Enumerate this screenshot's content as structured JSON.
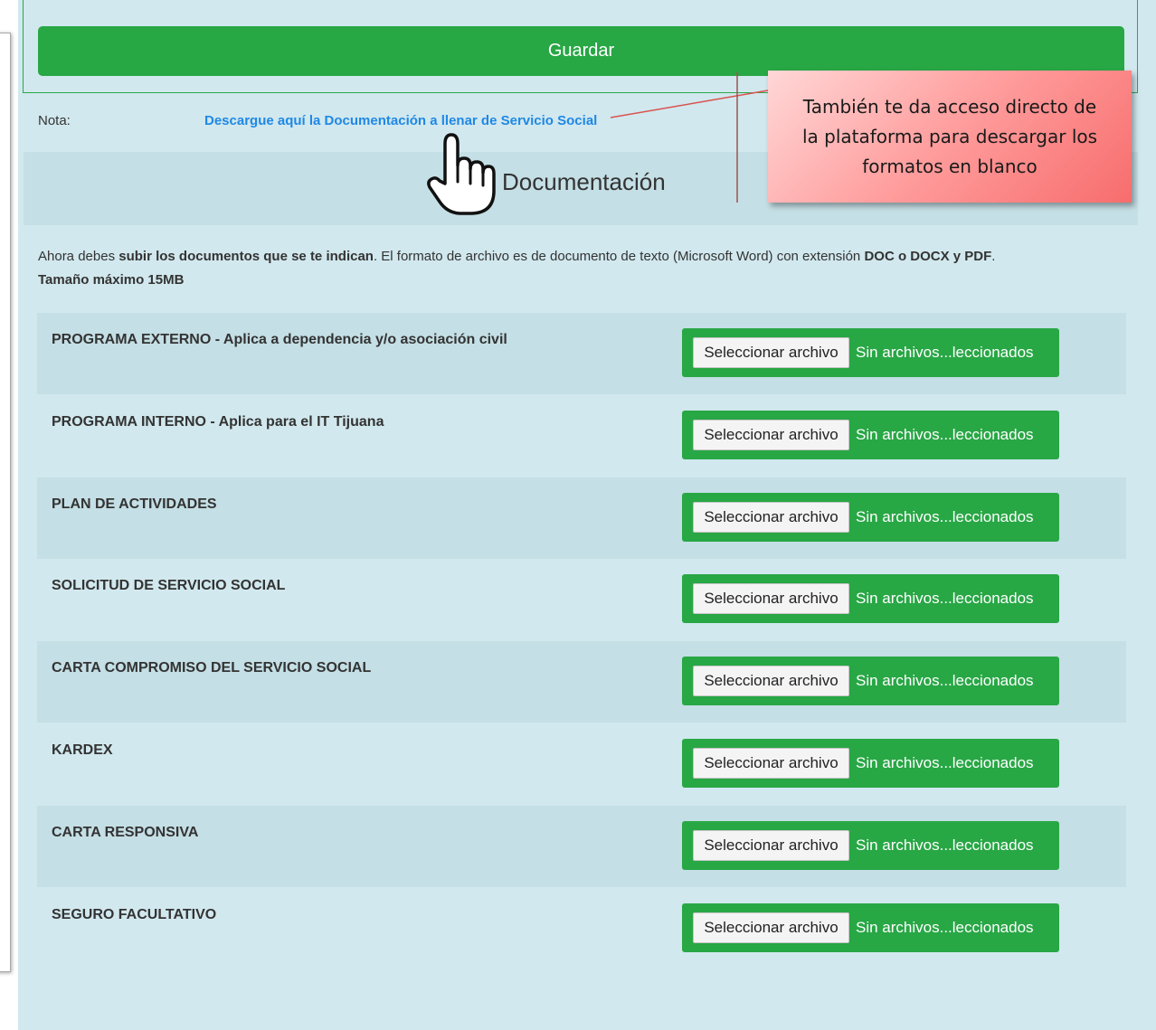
{
  "toolbar": {
    "save_label": "Guardar"
  },
  "note": {
    "label": "Nota:",
    "link_text": "Descargue aquí la Documentación a llenar de Servicio Social"
  },
  "section": {
    "title": "Documentación"
  },
  "instructions": {
    "part1": "Ahora debes ",
    "bold1": "subir los documentos que se te indican",
    "part2": ". El formato de archivo es de documento de texto (Microsoft Word) con extensión ",
    "bold2": "DOC o DOCX y PDF",
    "part3": ".",
    "line2": "Tamaño máximo 15MB"
  },
  "documents": [
    {
      "label": "PROGRAMA EXTERNO - Aplica a dependencia y/o asociación civil",
      "button": "Seleccionar archivo",
      "status": "Sin archivos...leccionados"
    },
    {
      "label": "PROGRAMA INTERNO - Aplica para el IT Tijuana",
      "button": "Seleccionar archivo",
      "status": "Sin archivos...leccionados"
    },
    {
      "label": "PLAN DE ACTIVIDADES",
      "button": "Seleccionar archivo",
      "status": "Sin archivos...leccionados"
    },
    {
      "label": "SOLICITUD DE SERVICIO SOCIAL",
      "button": "Seleccionar archivo",
      "status": "Sin archivos...leccionados"
    },
    {
      "label": "CARTA COMPROMISO DEL SERVICIO SOCIAL",
      "button": "Seleccionar archivo",
      "status": "Sin archivos...leccionados"
    },
    {
      "label": "KARDEX",
      "button": "Seleccionar archivo",
      "status": "Sin archivos...leccionados"
    },
    {
      "label": "CARTA RESPONSIVA",
      "button": "Seleccionar archivo",
      "status": "Sin archivos...leccionados"
    },
    {
      "label": "SEGURO FACULTATIVO",
      "button": "Seleccionar archivo",
      "status": "Sin archivos...leccionados"
    }
  ],
  "callout": {
    "line1": "También te da acceso directo de",
    "line2": "la plataforma para descargar los",
    "line3": "formatos en blanco"
  },
  "icons": {
    "pointer": "hand-pointer-icon"
  },
  "colors": {
    "accent_green": "#28a745",
    "link_blue": "#1f88e5",
    "page_bg": "#d1e8ee",
    "callout_red": "#f76d6d"
  }
}
